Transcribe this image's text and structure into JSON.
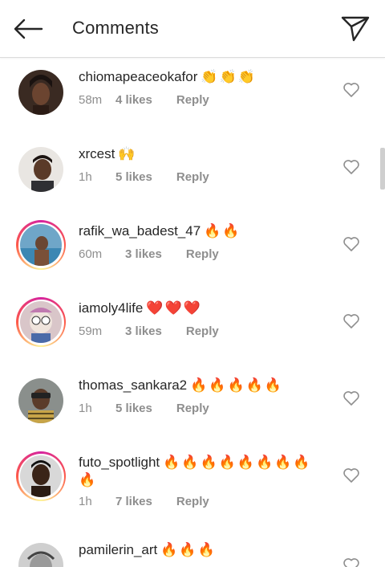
{
  "header": {
    "title": "Comments"
  },
  "comments": [
    {
      "user": "chiomapeaceokafor",
      "emoji": "👏👏👏",
      "time": "58m",
      "likes": "4 likes",
      "reply": "Reply"
    },
    {
      "user": "xrcest",
      "emoji": "🙌",
      "time": "1h",
      "likes": "5 likes",
      "reply": "Reply"
    },
    {
      "user": "rafik_wa_badest_47",
      "emoji": "🔥🔥",
      "time": "60m",
      "likes": "3 likes",
      "reply": "Reply"
    },
    {
      "user": "iamoly4life",
      "emoji": "❤️❤️❤️",
      "time": "59m",
      "likes": "3 likes",
      "reply": "Reply"
    },
    {
      "user": "thomas_sankara2",
      "emoji": "🔥🔥🔥🔥🔥",
      "time": "1h",
      "likes": "5 likes",
      "reply": "Reply"
    },
    {
      "user": "futo_spotlight",
      "emoji": "🔥🔥🔥🔥🔥🔥🔥🔥",
      "emoji_line2": "🔥",
      "time": "1h",
      "likes": "7 likes",
      "reply": "Reply"
    },
    {
      "user": "pamilerin_art",
      "emoji": "🔥🔥🔥"
    }
  ],
  "icons": {
    "back": "arrow-left-icon",
    "share": "paper-plane-icon",
    "like": "heart-outline-icon"
  },
  "colors": {
    "text": "#262626",
    "secondary": "#8e8e8e",
    "story_ring_start": "#d6249f",
    "story_ring_end": "#fd5949"
  }
}
